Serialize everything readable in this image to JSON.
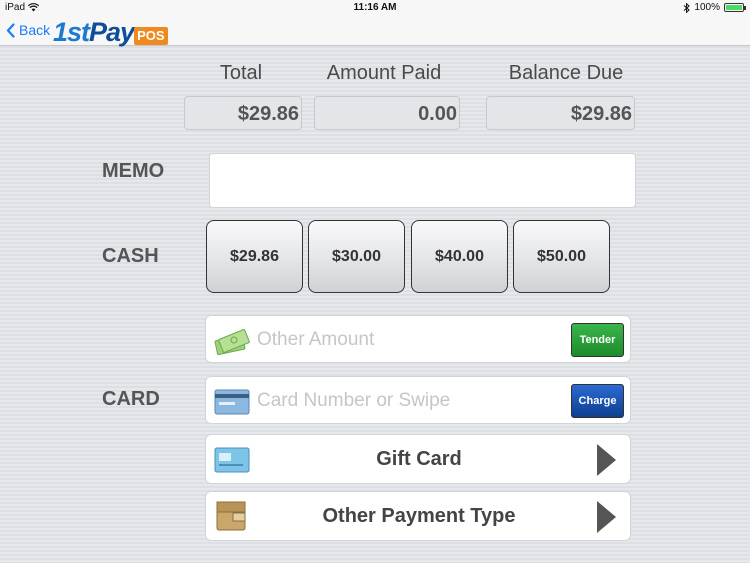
{
  "status": {
    "device": "iPad",
    "time": "11:16 AM",
    "battery": "100%"
  },
  "nav": {
    "back_label": "Back",
    "logo_num": "1st",
    "logo_pay": "Pay",
    "logo_pos": "POS"
  },
  "summary": {
    "total_label": "Total",
    "total_value": "$29.86",
    "paid_label": "Amount Paid",
    "paid_value": "0.00",
    "balance_label": "Balance Due",
    "balance_value": "$29.86"
  },
  "memo": {
    "label": "MEMO",
    "value": ""
  },
  "cash": {
    "label": "CASH",
    "buttons": [
      "$29.86",
      "$30.00",
      "$40.00",
      "$50.00"
    ]
  },
  "other_amount": {
    "placeholder": "Other Amount",
    "button": "Tender"
  },
  "card": {
    "label": "CARD",
    "placeholder": "Card Number or Swipe",
    "button": "Charge"
  },
  "gift_card": {
    "label": "Gift Card"
  },
  "other_payment": {
    "label": "Other Payment Type"
  },
  "colors": {
    "accent": "#1a7cf5",
    "tender": "#1d8c2b",
    "charge": "#0f3f8f",
    "logo_orange": "#f08a1e"
  }
}
